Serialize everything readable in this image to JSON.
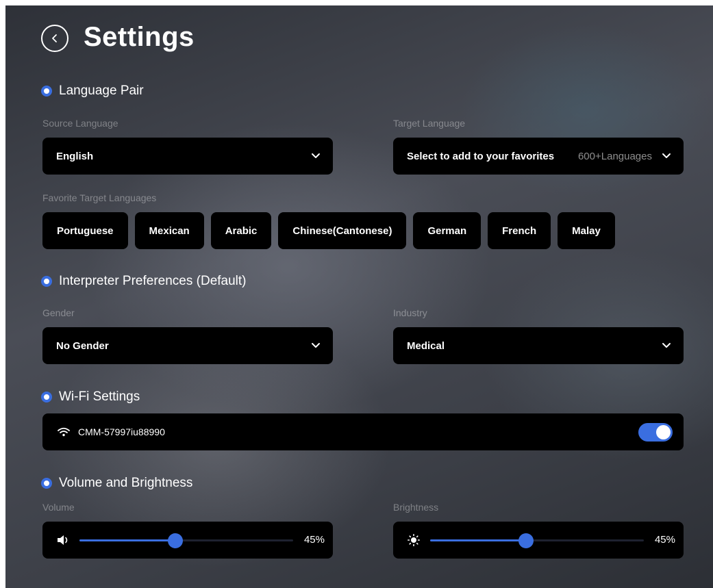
{
  "header": {
    "title": "Settings"
  },
  "language_pair": {
    "title": "Language Pair",
    "source_label": "Source Language",
    "source_value": "English",
    "target_label": "Target Language",
    "target_value": "Select to add to your favorites",
    "target_extra": "600+Languages",
    "favorites_label": "Favorite Target Languages",
    "favorites": [
      "Portuguese",
      "Mexican",
      "Arabic",
      "Chinese(Cantonese)",
      "German",
      "French",
      "Malay"
    ]
  },
  "interpreter": {
    "title": "Interpreter Preferences (Default)",
    "gender_label": "Gender",
    "gender_value": "No Gender",
    "industry_label": "Industry",
    "industry_value": "Medical"
  },
  "wifi": {
    "title": "Wi-Fi Settings",
    "network_name": "CMM-57997iu88990",
    "enabled": true
  },
  "volume_brightness": {
    "title": "Volume and Brightness",
    "volume_label": "Volume",
    "volume_value": 45,
    "volume_text": "45%",
    "brightness_label": "Brightness",
    "brightness_value": 45,
    "brightness_text": "45%"
  },
  "colors": {
    "accent": "#3a6ee0",
    "panel": "#000000"
  }
}
